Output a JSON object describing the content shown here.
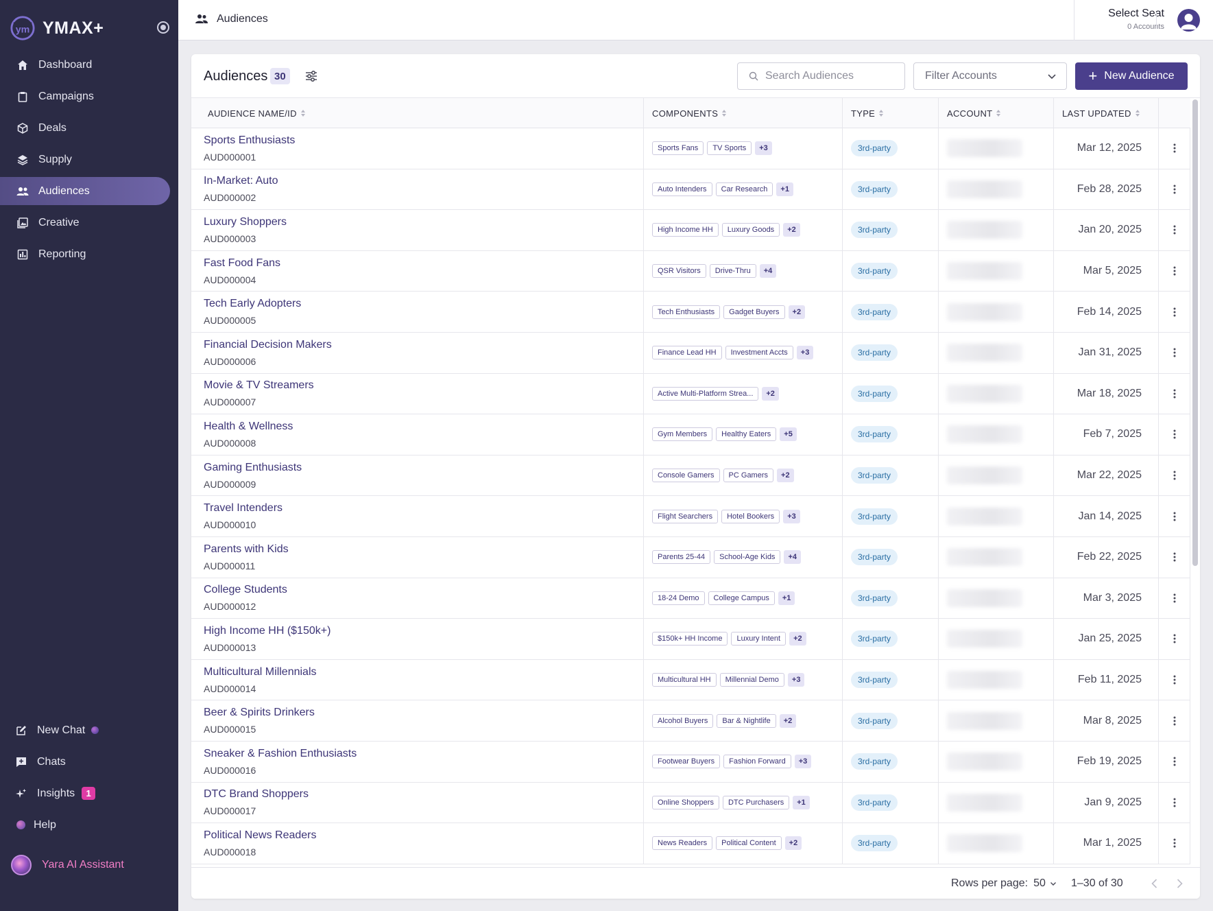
{
  "sidebar": {
    "brand": "YMAX+",
    "logo_text": "ym",
    "nav": [
      {
        "label": "Dashboard",
        "icon": "home-icon"
      },
      {
        "label": "Campaigns",
        "icon": "clipboard-icon"
      },
      {
        "label": "Deals",
        "icon": "cube-icon"
      },
      {
        "label": "Supply",
        "icon": "layers-icon"
      },
      {
        "label": "Audiences",
        "icon": "people-icon",
        "active": true
      },
      {
        "label": "Creative",
        "icon": "image-icon"
      },
      {
        "label": "Reporting",
        "icon": "report-icon"
      }
    ],
    "bottom": {
      "new_chat": "New Chat",
      "chats": "Chats",
      "insights": "Insights",
      "insights_badge": "1",
      "help": "Help"
    },
    "assistant": "Yara AI Assistant"
  },
  "topbar": {
    "page": "Audiences",
    "seat_title": "Select Seat",
    "seat_sub": "0 Accounts"
  },
  "card": {
    "title": "Audiences",
    "count": "30",
    "search_placeholder": "Search Audiences",
    "filter_placeholder": "Filter Accounts",
    "new_button": "New Audience"
  },
  "table": {
    "columns": {
      "name": "AUDIENCE NAME/ID",
      "components": "COMPONENTS",
      "type": "TYPE",
      "account": "ACCOUNT",
      "updated": "LAST UPDATED"
    },
    "rows": [
      {
        "name": "Sports Enthusiasts",
        "id": "AUD000001",
        "chips": [
          "Sports Fans",
          "TV Sports"
        ],
        "more": "+3",
        "type": "3rd-party",
        "date": "Mar 12, 2025"
      },
      {
        "name": "In-Market: Auto",
        "id": "AUD000002",
        "chips": [
          "Auto Intenders",
          "Car Research"
        ],
        "more": "+1",
        "type": "3rd-party",
        "date": "Feb 28, 2025"
      },
      {
        "name": "Luxury Shoppers",
        "id": "AUD000003",
        "chips": [
          "High Income HH",
          "Luxury Goods"
        ],
        "more": "+2",
        "type": "3rd-party",
        "date": "Jan 20, 2025"
      },
      {
        "name": "Fast Food Fans",
        "id": "AUD000004",
        "chips": [
          "QSR Visitors",
          "Drive-Thru"
        ],
        "more": "+4",
        "type": "3rd-party",
        "date": "Mar 5, 2025"
      },
      {
        "name": "Tech Early Adopters",
        "id": "AUD000005",
        "chips": [
          "Tech Enthusiasts",
          "Gadget Buyers"
        ],
        "more": "+2",
        "type": "3rd-party",
        "date": "Feb 14, 2025"
      },
      {
        "name": "Financial Decision Makers",
        "id": "AUD000006",
        "chips": [
          "Finance Lead HH",
          "Investment Accts"
        ],
        "more": "+3",
        "type": "3rd-party",
        "date": "Jan 31, 2025"
      },
      {
        "name": "Movie & TV Streamers",
        "id": "AUD000007",
        "chips": [
          "Active Multi-Platform Strea..."
        ],
        "more": "+2",
        "type": "3rd-party",
        "date": "Mar 18, 2025"
      },
      {
        "name": "Health & Wellness",
        "id": "AUD000008",
        "chips": [
          "Gym Members",
          "Healthy Eaters"
        ],
        "more": "+5",
        "type": "3rd-party",
        "date": "Feb 7, 2025"
      },
      {
        "name": "Gaming Enthusiasts",
        "id": "AUD000009",
        "chips": [
          "Console Gamers",
          "PC Gamers"
        ],
        "more": "+2",
        "type": "3rd-party",
        "date": "Mar 22, 2025"
      },
      {
        "name": "Travel Intenders",
        "id": "AUD000010",
        "chips": [
          "Flight Searchers",
          "Hotel Bookers"
        ],
        "more": "+3",
        "type": "3rd-party",
        "date": "Jan 14, 2025"
      },
      {
        "name": "Parents with Kids",
        "id": "AUD000011",
        "chips": [
          "Parents 25-44",
          "School-Age Kids"
        ],
        "more": "+4",
        "type": "3rd-party",
        "date": "Feb 22, 2025"
      },
      {
        "name": "College Students",
        "id": "AUD000012",
        "chips": [
          "18-24 Demo",
          "College Campus"
        ],
        "more": "+1",
        "type": "3rd-party",
        "date": "Mar 3, 2025"
      },
      {
        "name": "High Income HH ($150k+)",
        "id": "AUD000013",
        "chips": [
          "$150k+ HH Income",
          "Luxury Intent"
        ],
        "more": "+2",
        "type": "3rd-party",
        "date": "Jan 25, 2025"
      },
      {
        "name": "Multicultural Millennials",
        "id": "AUD000014",
        "chips": [
          "Multicultural HH",
          "Millennial Demo"
        ],
        "more": "+3",
        "type": "3rd-party",
        "date": "Feb 11, 2025"
      },
      {
        "name": "Beer & Spirits Drinkers",
        "id": "AUD000015",
        "chips": [
          "Alcohol Buyers",
          "Bar & Nightlife"
        ],
        "more": "+2",
        "type": "3rd-party",
        "date": "Mar 8, 2025"
      },
      {
        "name": "Sneaker & Fashion Enthusiasts",
        "id": "AUD000016",
        "chips": [
          "Footwear Buyers",
          "Fashion Forward"
        ],
        "more": "+3",
        "type": "3rd-party",
        "date": "Feb 19, 2025"
      },
      {
        "name": "DTC Brand Shoppers",
        "id": "AUD000017",
        "chips": [
          "Online Shoppers",
          "DTC Purchasers"
        ],
        "more": "+1",
        "type": "3rd-party",
        "date": "Jan 9, 2025"
      },
      {
        "name": "Political News Readers",
        "id": "AUD000018",
        "chips": [
          "News Readers",
          "Political Content"
        ],
        "more": "+2",
        "type": "3rd-party",
        "date": "Mar 1, 2025"
      }
    ]
  },
  "footer": {
    "rows_per_page_label": "Rows per page:",
    "rows_per_page_value": "50",
    "range": "1–30 of 30"
  },
  "colors": {
    "sidebar_bg": "#2b2b45",
    "accent": "#4a3f8c",
    "link": "#3d3577",
    "active_nav": "#6f65a8",
    "pill_bg": "#e3f0fa",
    "pill_text": "#2a6ea3",
    "assistant_pink": "#f27fc7"
  }
}
